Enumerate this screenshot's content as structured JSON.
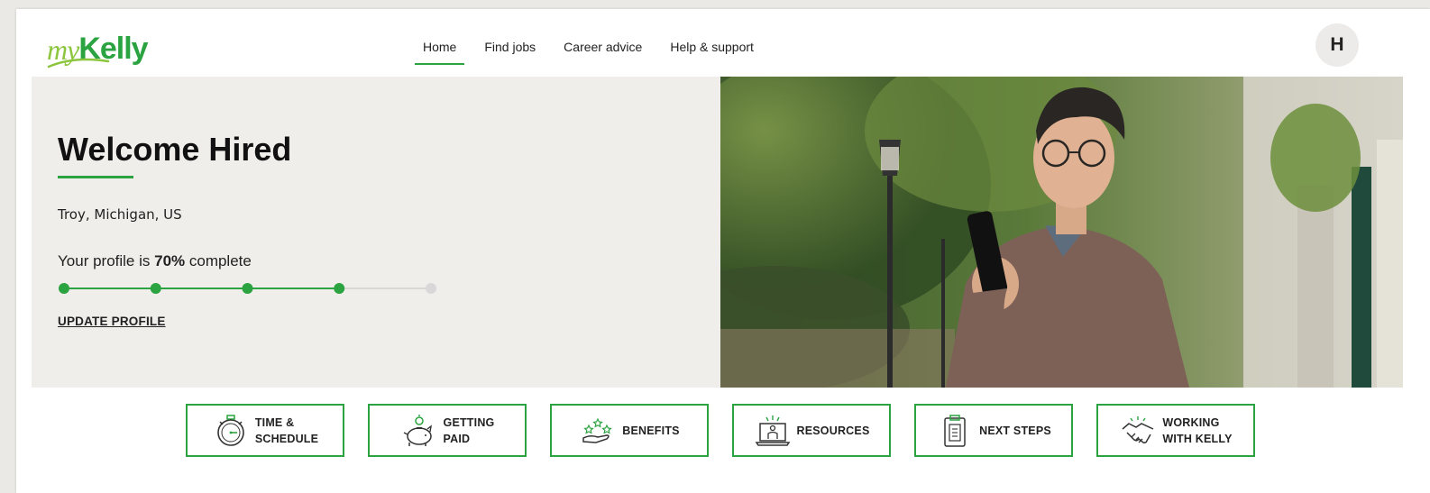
{
  "brand": {
    "logo_my": "my",
    "logo_kelly": "Kelly",
    "primary_color": "#2ba340",
    "accent_color": "#8cc63f"
  },
  "nav": {
    "items": [
      {
        "label": "Home",
        "active": true
      },
      {
        "label": "Find jobs",
        "active": false
      },
      {
        "label": "Career advice",
        "active": false
      },
      {
        "label": "Help & support",
        "active": false
      }
    ]
  },
  "user": {
    "avatar_initial": "H"
  },
  "hero": {
    "welcome": "Welcome Hired",
    "location": "Troy, Michigan, US",
    "profile_prefix": "Your profile is ",
    "profile_percent": "70%",
    "profile_suffix": " complete",
    "progress_steps_total": 5,
    "progress_steps_complete": 4,
    "update_link": "UPDATE PROFILE"
  },
  "tiles": [
    {
      "label": "TIME &\nSCHEDULE",
      "icon": "stopwatch-icon"
    },
    {
      "label": "GETTING\nPAID",
      "icon": "piggy-bank-icon"
    },
    {
      "label": "BENEFITS",
      "icon": "hand-stars-icon"
    },
    {
      "label": "RESOURCES",
      "icon": "laptop-person-icon"
    },
    {
      "label": "NEXT STEPS",
      "icon": "clipboard-icon"
    },
    {
      "label": "WORKING\nWITH KELLY",
      "icon": "handshake-icon"
    }
  ]
}
